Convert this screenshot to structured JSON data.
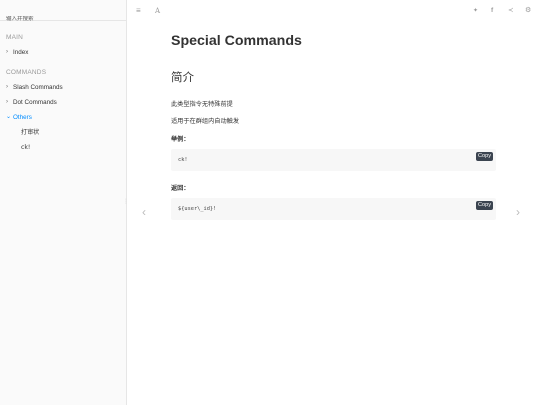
{
  "sidebar": {
    "search_placeholder": "输入并搜索",
    "sections": [
      {
        "title": "MAIN"
      },
      {
        "title": "COMMANDS"
      }
    ],
    "items": [
      {
        "label": "Index"
      },
      {
        "label": "Slash Commands"
      },
      {
        "label": "Dot Commands"
      },
      {
        "label": "Others"
      }
    ],
    "sub_items": [
      {
        "label": "打审状"
      },
      {
        "label": "ck!"
      }
    ]
  },
  "header": {
    "icons": [
      "menu-icon",
      "font-icon",
      "twitter-icon",
      "facebook-icon",
      "share-icon",
      "settings-icon"
    ]
  },
  "content": {
    "title": "Special Commands",
    "section_heading": "简介",
    "desc1": "此类型指令无特殊前提",
    "desc2": "适用于在群组内自动触发",
    "example_label": "举例：",
    "example_code": "ck!",
    "return_label": "返回：",
    "return_code": "${user\\_id}!",
    "copy_label": "Copy"
  },
  "pager": {
    "prev": "‹",
    "next": "›"
  }
}
